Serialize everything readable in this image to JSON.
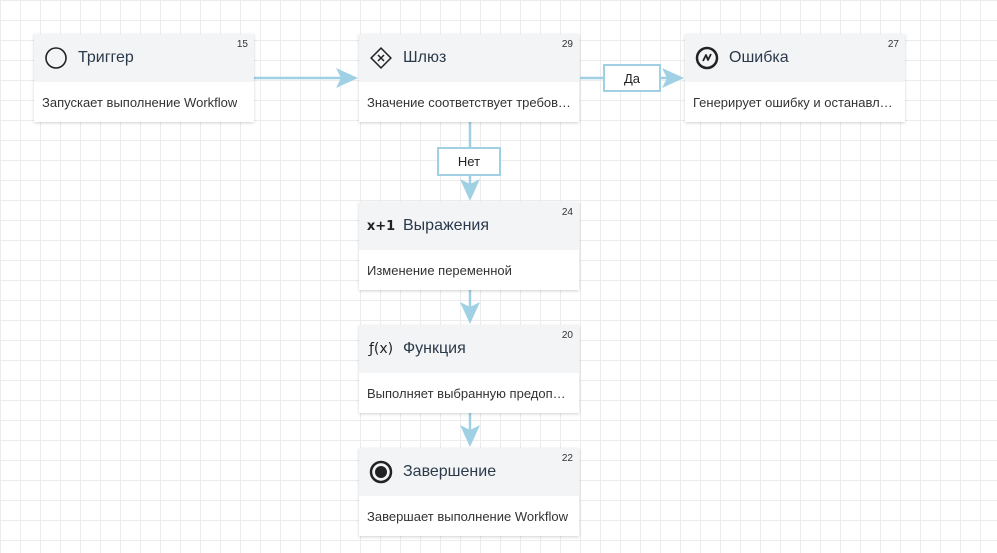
{
  "nodes": {
    "trigger": {
      "title": "Триггер",
      "id": "15",
      "desc": "Запускает выполнение Workflow",
      "icon": "circle-outline-icon"
    },
    "gateway": {
      "title": "Шлюз",
      "id": "29",
      "desc": "Значение соответствует требованиям",
      "icon": "diamond-x-icon"
    },
    "error": {
      "title": "Ошибка",
      "id": "27",
      "desc": "Генерирует ошибку и останавливает выполнение",
      "icon": "lightning-circle-icon"
    },
    "expression": {
      "title": "Выражения",
      "id": "24",
      "desc": "Изменение переменной",
      "icon": "x-plus-one-icon",
      "icon_text": "x+1"
    },
    "function": {
      "title": "Функция",
      "id": "20",
      "desc": "Выполняет выбранную предопределённую функцию",
      "icon": "function-icon",
      "icon_text": "ƒ(x)"
    },
    "end": {
      "title": "Завершение",
      "id": "22",
      "desc": "Завершает выполнение Workflow",
      "icon": "end-circle-icon"
    }
  },
  "edge_labels": {
    "yes": "Да",
    "no": "Нет"
  },
  "colors": {
    "edge": "#9fd0e4",
    "header": "#f3f4f6",
    "grid": "#ececec"
  }
}
